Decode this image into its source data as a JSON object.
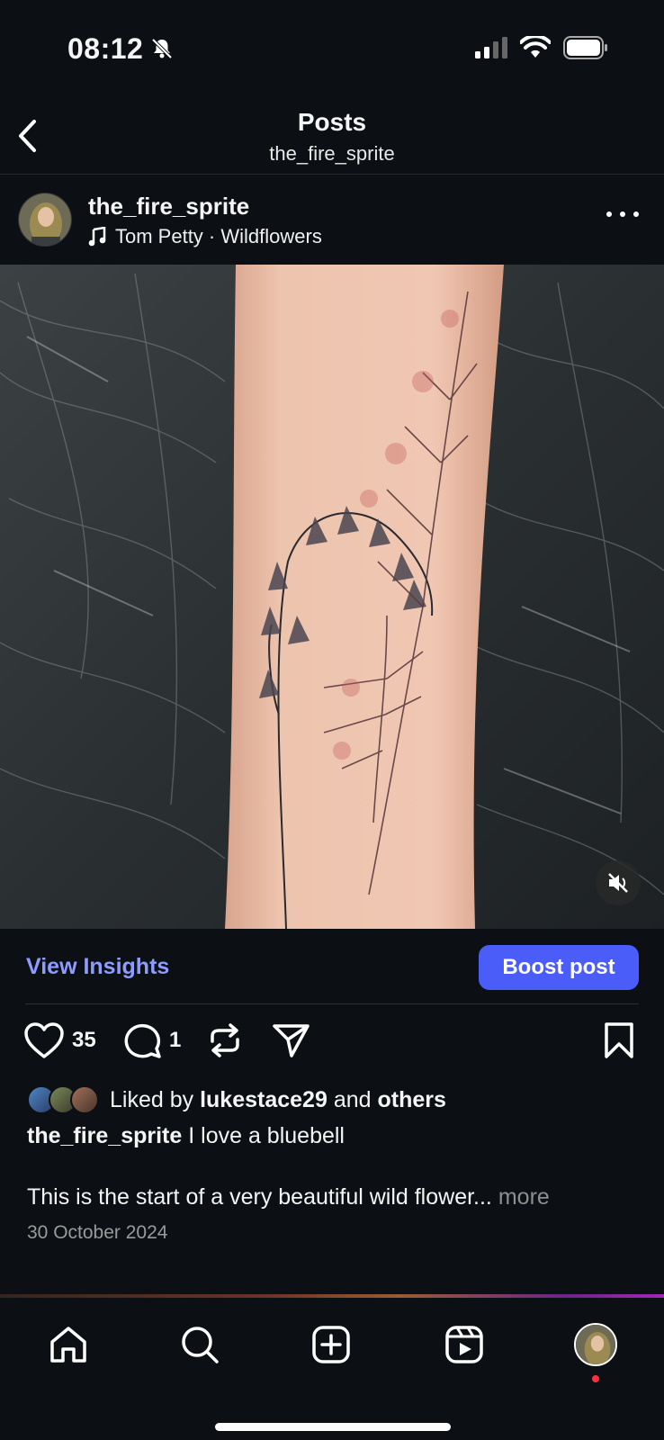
{
  "status_bar": {
    "time": "08:12"
  },
  "header": {
    "title": "Posts",
    "subtitle": "the_fire_sprite"
  },
  "post": {
    "username": "the_fire_sprite",
    "music": "Tom Petty · Wildflowers",
    "view_insights": "View Insights",
    "boost_label": "Boost post",
    "likes_count": "35",
    "comments_count": "1",
    "liked_by_prefix": "Liked by",
    "liked_by_user": "lukestace29",
    "liked_by_and": "and",
    "liked_by_others": "others",
    "caption_user": "the_fire_sprite",
    "caption_text": "I love a bluebell",
    "caption_body": "This is the start of a very beautiful wild flower...",
    "caption_more": "more",
    "date": "30 October 2024"
  },
  "icons": {
    "back": "chevron-left-icon",
    "music": "music-note-icon",
    "more": "more-horizontal-icon",
    "mute": "speaker-muted-icon",
    "like": "heart-icon",
    "comment": "comment-icon",
    "repost": "repost-icon",
    "share": "send-icon",
    "save": "bookmark-icon"
  },
  "tabs": [
    "home",
    "search",
    "create",
    "reels",
    "profile"
  ],
  "colors": {
    "background": "#0c1014",
    "accent": "#4a5df9",
    "link": "#8e9cff",
    "notification": "#ff3040"
  }
}
